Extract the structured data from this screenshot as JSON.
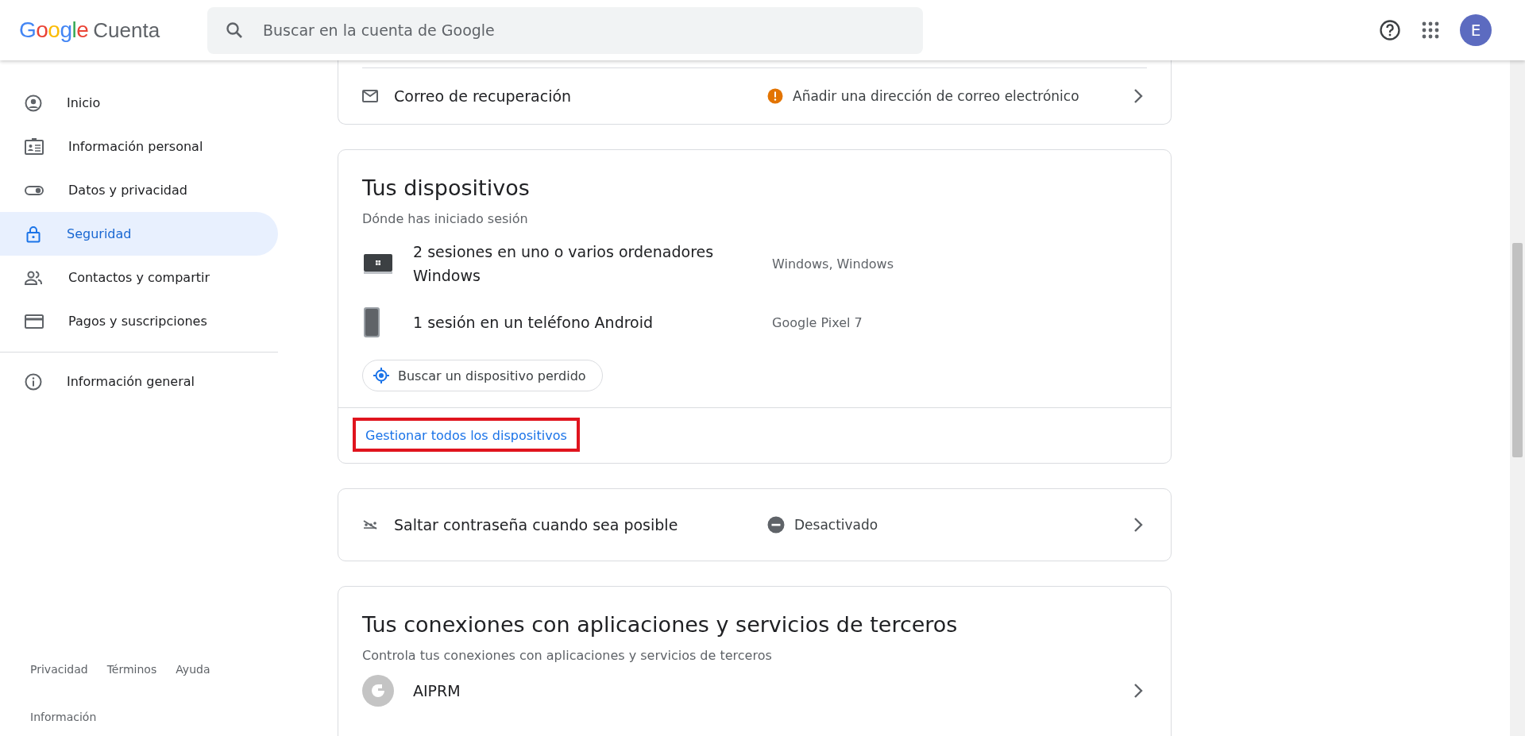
{
  "header": {
    "logo": {
      "brand": "Google",
      "product": "Cuenta"
    },
    "search": {
      "placeholder": "Buscar en la cuenta de Google"
    },
    "avatar": "E"
  },
  "sidebar": {
    "items": [
      {
        "label": "Inicio",
        "kind": "person",
        "selected": false
      },
      {
        "label": "Información personal",
        "kind": "idcard",
        "selected": false
      },
      {
        "label": "Datos y privacidad",
        "kind": "toggle",
        "selected": false
      },
      {
        "label": "Seguridad",
        "kind": "lock",
        "selected": true
      },
      {
        "label": "Contactos y compartir",
        "kind": "people",
        "selected": false
      },
      {
        "label": "Pagos y suscripciones",
        "kind": "card",
        "selected": false
      }
    ],
    "secondary": [
      {
        "label": "Información general",
        "kind": "info",
        "selected": false
      }
    ],
    "footer_links": [
      "Privacidad",
      "Términos",
      "Ayuda"
    ],
    "footer_link_2": "Información"
  },
  "recovery_row": {
    "label": "Correo de recuperación",
    "status": "Añadir una dirección de correo electrónico",
    "kind": "warning"
  },
  "devices_card": {
    "title": "Tus dispositivos",
    "subtitle": "Dónde has iniciado sesión",
    "devices": [
      {
        "kind": "laptop",
        "label": "2 sesiones en uno o varios ordenadores Windows",
        "detail": "Windows, Windows"
      },
      {
        "kind": "phone",
        "label": "1 sesión en un teléfono Android",
        "detail": "Google Pixel 7"
      }
    ],
    "find_button": "Buscar un dispositivo perdido",
    "manage_link": "Gestionar todos los dispositivos",
    "manage_link_highlighted": true
  },
  "passkey_row": {
    "label": "Saltar contraseña cuando sea posible",
    "status": "Desactivado",
    "kind": "off"
  },
  "connections_card": {
    "title": "Tus conexiones con aplicaciones y servicios de terceros",
    "subtitle": "Controla tus conexiones con aplicaciones y servicios de terceros",
    "apps": [
      {
        "name": "AIPRM"
      }
    ]
  }
}
